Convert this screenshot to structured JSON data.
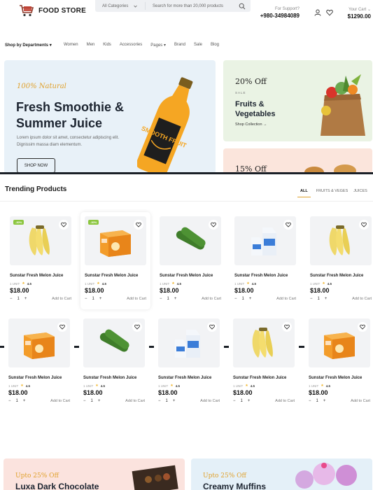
{
  "header": {
    "logo_text": "FOOD STORE",
    "category_select": "All Categories",
    "search_placeholder": "Search for more than 20,000 products",
    "support_label": "For Support?",
    "support_phone": "+980-34984089",
    "cart_label": "Your Cart",
    "cart_total": "$1290.00"
  },
  "nav": {
    "departments": "Shop by Departments",
    "links": [
      "Women",
      "Men",
      "Kids",
      "Accessories",
      "Pages",
      "Brand",
      "Sale",
      "Blog"
    ]
  },
  "hero": {
    "eyebrow": "100% Natural",
    "title": "Fresh Smoothie & Summer Juice",
    "description": "Lorem ipsum dolor sit amet, consectetur adipiscing elit. Dignissim massa diam elementum.",
    "button": "SHOP NOW",
    "bottle_text": "SMOOTH FRUIT"
  },
  "promo_fruits": {
    "discount": "20% Off",
    "sale": "SALE",
    "title": "Fruits & Vegetables",
    "link": "Shop Collection →"
  },
  "promo_second": {
    "discount": "15% Off"
  },
  "trending": {
    "title": "Trending Products",
    "tabs": [
      "ALL",
      "FRUITS & VEGES",
      "JUICES"
    ]
  },
  "products": [
    {
      "name": "Sunstar Fresh Melon Juice",
      "unit": "1 UNIT",
      "rating": "4.5",
      "price": "$18.00",
      "qty": "1",
      "add": "Add to Cart",
      "badge": "-30%",
      "kind": "banana"
    },
    {
      "name": "Sunstar Fresh Melon Juice",
      "unit": "1 UNIT",
      "rating": "4.5",
      "price": "$18.00",
      "qty": "1",
      "add": "Add to Cart",
      "badge": "-30%",
      "kind": "box"
    },
    {
      "name": "Sunstar Fresh Melon Juice",
      "unit": "1 UNIT",
      "rating": "4.5",
      "price": "$18.00",
      "qty": "1",
      "add": "Add to Cart",
      "badge": "",
      "kind": "cucumber"
    },
    {
      "name": "Sunstar Fresh Melon Juice",
      "unit": "1 UNIT",
      "rating": "4.5",
      "price": "$18.00",
      "qty": "1",
      "add": "Add to Cart",
      "badge": "",
      "kind": "milk"
    },
    {
      "name": "Sunstar Fresh Melon Juice",
      "unit": "1 UNIT",
      "rating": "4.5",
      "price": "$18.00",
      "qty": "1",
      "add": "Add to Cart",
      "badge": "",
      "kind": "banana"
    },
    {
      "name": "Sunstar Fresh Melon Juice",
      "unit": "1 UNIT",
      "rating": "4.5",
      "price": "$18.00",
      "qty": "1",
      "add": "Add to Cart",
      "badge": "",
      "kind": "box"
    },
    {
      "name": "Sunstar Fresh Melon Juice",
      "unit": "1 UNIT",
      "rating": "4.5",
      "price": "$18.00",
      "qty": "1",
      "add": "Add to Cart",
      "badge": "",
      "kind": "cucumber"
    },
    {
      "name": "Sunstar Fresh Melon Juice",
      "unit": "1 UNIT",
      "rating": "4.5",
      "price": "$18.00",
      "qty": "1",
      "add": "Add to Cart",
      "badge": "",
      "kind": "milk"
    },
    {
      "name": "Sunstar Fresh Melon Juice",
      "unit": "1 UNIT",
      "rating": "4.5",
      "price": "$18.00",
      "qty": "1",
      "add": "Add to Cart",
      "badge": "",
      "kind": "banana"
    },
    {
      "name": "Sunstar Fresh Melon Juice",
      "unit": "1 UNIT",
      "rating": "4.5",
      "price": "$18.00",
      "qty": "1",
      "add": "Add to Cart",
      "badge": "",
      "kind": "box"
    }
  ],
  "banners": [
    {
      "discount": "Upto 25% Off",
      "title": "Luxa Dark Chocolate"
    },
    {
      "discount": "Upto 25% Off",
      "title": "Creamy Muffins"
    }
  ],
  "colors": {
    "accent": "#e0a12c",
    "badge_green": "#8cc63f",
    "hero_bg": "#e8f1f8",
    "promo_green": "#eaf3e4",
    "promo_pink": "#fbe5dc",
    "divider": "#1b2027"
  }
}
